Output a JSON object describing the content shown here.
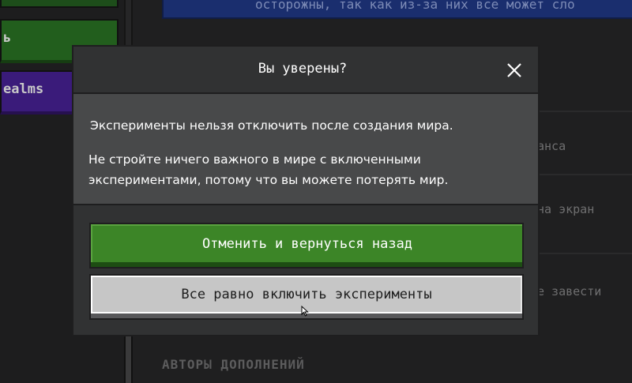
{
  "background": {
    "top_banner_text": "осторожны, так как из-за них все может сло",
    "left_buttons": [
      {
        "label": ""
      },
      {
        "label": "ь"
      },
      {
        "label": "ealms"
      }
    ],
    "rows": [
      {
        "label": "анса"
      },
      {
        "label": "на экран"
      },
      {
        "label": "е завести"
      }
    ],
    "section_title": "АВТОРЫ ДОПОЛНЕНИЙ"
  },
  "modal": {
    "title": "Вы уверены?",
    "close_icon": "close-icon",
    "paragraph1": "Эксперименты нельзя отключить после создания мира.",
    "paragraph2_line1": "Не стройте ничего важного в мире с включенными",
    "paragraph2_line2": "экспериментами, потому что вы можете потерять мир.",
    "cancel_label": "Отменить и вернуться назад",
    "confirm_label": "Все равно включить эксперименты"
  },
  "colors": {
    "primary_button": "#3c8527",
    "secondary_button": "#c6c6c6",
    "modal_header": "#313233",
    "modal_body": "#48494a"
  }
}
